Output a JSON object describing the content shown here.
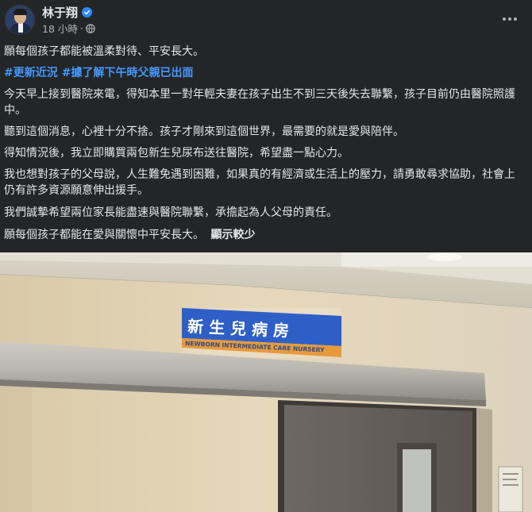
{
  "post": {
    "author": "林于翔",
    "time": "18 小時",
    "separator": "·",
    "lines": [
      "願每個孩子都能被溫柔對待、平安長大。",
      "今天早上接到醫院來電，得知本里一對年輕夫妻在孩子出生不到三天後失去聯繫，孩子目前仍由醫院照護中。",
      "聽到這個消息，心裡十分不捨。孩子才剛來到這個世界，最需要的就是愛與陪伴。",
      "得知情況後，我立即購買兩包新生兒尿布送往醫院，希望盡一點心力。",
      "我也想對孩子的父母說，人生難免遇到困難，如果真的有經濟或生活上的壓力，請勇敢尋求協助，社會上仍有許多資源願意伸出援手。",
      "我們誠摯希望兩位家長能盡速與醫院聯繫，承擔起為人父母的責任。",
      "願每個孩子都能在愛與關懷中平安長大。"
    ],
    "hashtags": [
      "#更新近況",
      "#據了解下午時父親已出面"
    ],
    "see_less": "顯示較少"
  },
  "photo": {
    "sign_zh": "新 生 兒 病 房",
    "sign_en": "NEWBORN INTERMEDIATE CARE NURSERY"
  },
  "icons": {
    "verified": "verified-badge-icon",
    "privacy": "globe-icon",
    "menu": "more-options-icon"
  },
  "colors": {
    "background": "#242526",
    "hashtag": "#4599ff",
    "verified": "#2d88ff"
  }
}
